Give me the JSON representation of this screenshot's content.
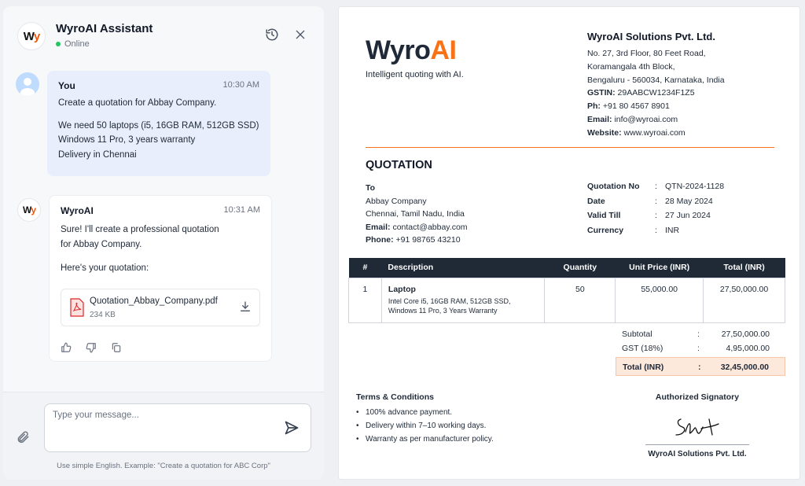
{
  "chat": {
    "title": "WyroAI Assistant",
    "status": "Online",
    "logo_text_w": "W",
    "logo_text_y": "y",
    "messages": {
      "user": {
        "name": "You",
        "time": "10:30 AM",
        "lines": [
          "Create a quotation for Abbay Company.",
          "We need 50 laptops (i5, 16GB RAM, 512GB SSD)",
          "Windows 11 Pro, 3 years warranty",
          "Delivery in Chennai"
        ]
      },
      "bot": {
        "name": "WyroAI",
        "time": "10:31 AM",
        "lines": [
          "Sure! I'll create a professional quotation",
          "for Abbay Company.",
          "Here's your quotation:"
        ],
        "file": {
          "name": "Quotation_Abbay_Company.pdf",
          "size": "234 KB"
        }
      }
    },
    "composer": {
      "placeholder": "Type your message...",
      "hint": "Use simple English. Example: \"Create a quotation for ABC Corp\""
    }
  },
  "doc": {
    "brand_a": "Wyro",
    "brand_b": "AI",
    "tagline": "Intelligent quoting with AI.",
    "company": {
      "name": "WyroAI Solutions Pvt. Ltd.",
      "address": [
        "No. 27, 3rd Floor, 80 Feet Road,",
        "Koramangala 4th Block,",
        "Bengaluru - 560034, Karnataka, India"
      ],
      "gstin_label": "GSTIN:",
      "gstin": "29AABCW1234F1Z5",
      "phone_label": "Ph:",
      "phone": "+91 80 4567 8901",
      "email_label": "Email:",
      "email": "info@wyroai.com",
      "website_label": "Website:",
      "website": "www.wyroai.com"
    },
    "title": "QUOTATION",
    "to": {
      "label": "To",
      "name": "Abbay Company",
      "location": "Chennai, Tamil Nadu, India",
      "email_label": "Email:",
      "email": "contact@abbay.com",
      "phone_label": "Phone:",
      "phone": "+91 98765 43210"
    },
    "meta": [
      {
        "k": "Quotation No",
        "v": "QTN-2024-1128"
      },
      {
        "k": "Date",
        "v": "28 May 2024"
      },
      {
        "k": "Valid Till",
        "v": "27 Jun 2024"
      },
      {
        "k": "Currency",
        "v": "INR"
      }
    ],
    "table": {
      "headers": [
        "#",
        "Description",
        "Quantity",
        "Unit Price (INR)",
        "Total (INR)"
      ],
      "rows": [
        {
          "no": "1",
          "item": "Laptop",
          "desc": [
            "Intel Core i5, 16GB RAM, 512GB SSD,",
            "Windows 11 Pro, 3 Years Warranty"
          ],
          "qty": "50",
          "unit": "55,000.00",
          "total": "27,50,000.00"
        }
      ]
    },
    "totals": {
      "subtotal_label": "Subtotal",
      "subtotal": "27,50,000.00",
      "gst_label": "GST (18%)",
      "gst": "4,95,000.00",
      "total_label": "Total (INR)",
      "total": "32,45,000.00",
      "colon": ":"
    },
    "terms": {
      "title": "Terms & Conditions",
      "items": [
        "100% advance payment.",
        "Delivery within 7–10 working days.",
        "Warranty as per manufacturer policy."
      ]
    },
    "signatory": {
      "title": "Authorized Signatory",
      "name": "WyroAI Solutions Pvt. Ltd."
    }
  },
  "colors": {
    "accent": "#f97316",
    "table_header": "#1f2a36",
    "online": "#22c55e"
  }
}
